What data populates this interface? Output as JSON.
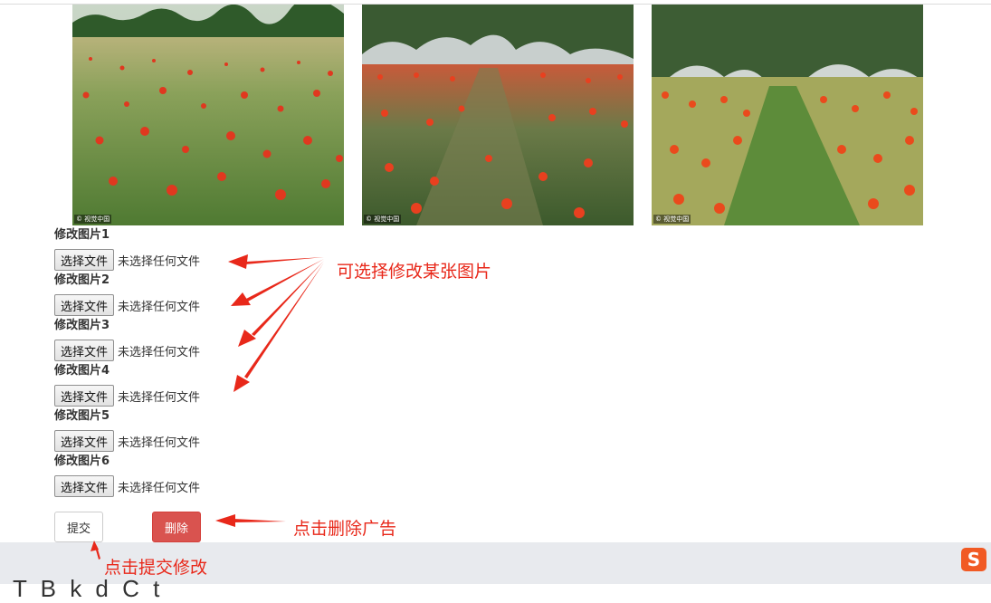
{
  "photos": [
    {
      "watermark": "© 视觉中国"
    },
    {
      "watermark": "© 视觉中国"
    },
    {
      "watermark": "© 视觉中国"
    }
  ],
  "form": {
    "fields": [
      {
        "label": "修改图片1",
        "button": "选择文件",
        "status": "未选择任何文件"
      },
      {
        "label": "修改图片2",
        "button": "选择文件",
        "status": "未选择任何文件"
      },
      {
        "label": "修改图片3",
        "button": "选择文件",
        "status": "未选择任何文件"
      },
      {
        "label": "修改图片4",
        "button": "选择文件",
        "status": "未选择任何文件"
      },
      {
        "label": "修改图片5",
        "button": "选择文件",
        "status": "未选择任何文件"
      },
      {
        "label": "修改图片6",
        "button": "选择文件",
        "status": "未选择任何文件"
      }
    ],
    "submit_label": "提交",
    "delete_label": "删除"
  },
  "annotations": {
    "select_hint": "可选择修改某张图片",
    "delete_hint": "点击删除广告",
    "submit_hint": "点击提交修改"
  },
  "footer": {
    "text": "T     B   k    d  C    t",
    "ime_icon": "sogou-ime-icon",
    "ime_glyph": "S"
  },
  "colors": {
    "annotation": "#e8281a",
    "delete_button": "#d9534f",
    "footer_bg": "#e8eaee"
  }
}
